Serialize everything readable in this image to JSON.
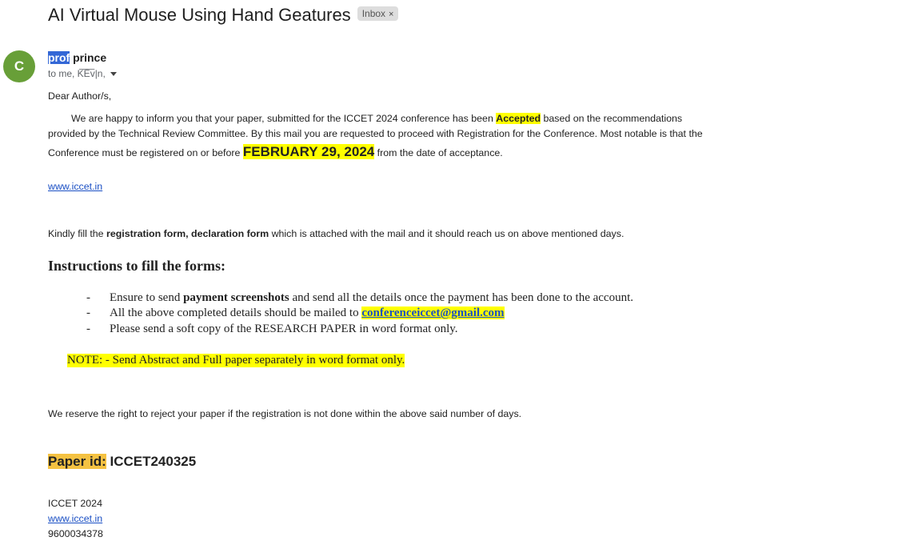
{
  "subject": "AI Virtual Mouse Using Hand Geatures",
  "label": "Inbox",
  "label_close": "×",
  "avatar_letter": "C",
  "sender": {
    "first": "prof",
    "last": " prince"
  },
  "recipients": "to me, K͞E͞v|n,",
  "greeting": "Dear Author/s,",
  "p1": {
    "a": "We are happy to inform you that your paper, submitted for the ICCET 2024 conference has been ",
    "accepted": "Accepted",
    "b": " based on the recommendations",
    "line2": "provided by the Technical Review Committee. By this mail you are requested to proceed with Registration for the Conference. Most notable is that the",
    "line3a": "Conference must be registered on or before ",
    "deadline": "FEBRUARY 29, 2024",
    "line3b": " from the date of acceptance."
  },
  "website": "www.iccet.in",
  "fill": {
    "a": "Kindly fill the ",
    "forms": "registration form, declaration form",
    "b": " which is attached with the mail and it should reach us on above mentioned days."
  },
  "instructions_heading": "Instructions to fill the forms:",
  "bullets": {
    "dash": "-",
    "b1a": "Ensure to send ",
    "b1bold": "payment screenshots",
    "b1b": " and send all the details once the payment has been done to the account.",
    "b2a": "All the above completed details should be mailed to ",
    "b2email": "conferenceiccet@gmail.com",
    "b3": "Please send a soft copy of the RESEARCH PAPER in word format only."
  },
  "note": "NOTE: - Send Abstract and Full paper separately in word format only.",
  "reserve": "We reserve the right to reject your paper if the registration is not done within the above said number of days.",
  "paper_id": {
    "label": "Paper id:",
    "value": " ICCET240325"
  },
  "signature": {
    "org": "ICCET 2024",
    "website": "www.iccet.in",
    "phone": "9600034378"
  },
  "colors": {
    "highlight": "#ffff00",
    "avatar": "#689f38",
    "link": "#1a4fc4",
    "paper_label": "#f5c242"
  }
}
